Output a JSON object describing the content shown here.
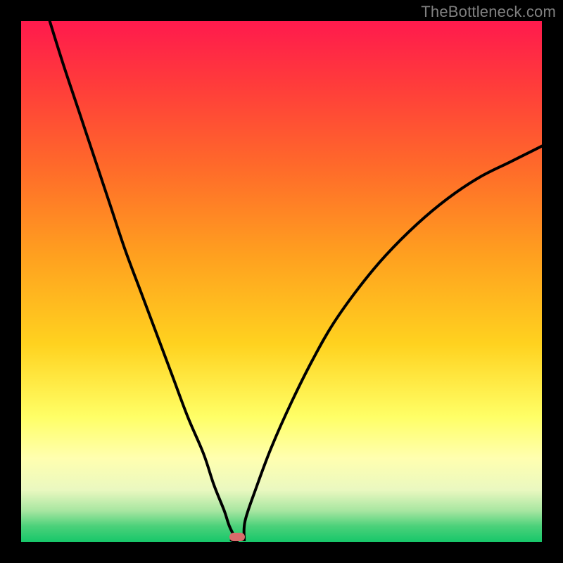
{
  "watermark": "TheBottleneck.com",
  "marker": {
    "x_pct": 41.5,
    "y_pct": 99.0
  },
  "colors": {
    "frame": "#000000",
    "curve": "#000000",
    "marker": "#d86b6b",
    "watermark": "#808080"
  },
  "chart_data": {
    "type": "line",
    "title": "",
    "xlabel": "",
    "ylabel": "",
    "xlim": [
      0,
      100
    ],
    "ylim": [
      0,
      100
    ],
    "background_gradient": "red-yellow-green (top to bottom)",
    "notch_x_pct": 41.5,
    "marker": {
      "x_pct": 41.5,
      "y_pct": 0
    },
    "series": [
      {
        "name": "left-branch",
        "x": [
          5.5,
          8,
          11,
          14,
          17,
          20,
          23,
          26,
          29,
          32,
          35,
          37,
          39,
          40,
          41.5
        ],
        "values": [
          100,
          92,
          83,
          74,
          65,
          56,
          48,
          40,
          32,
          24,
          17,
          11,
          6,
          3,
          0
        ]
      },
      {
        "name": "right-branch",
        "x": [
          41.5,
          43,
          45,
          48,
          52,
          56,
          60,
          65,
          70,
          76,
          82,
          88,
          94,
          100
        ],
        "values": [
          0,
          4,
          10,
          18,
          27,
          35,
          42,
          49,
          55,
          61,
          66,
          70,
          73,
          76
        ]
      }
    ]
  }
}
